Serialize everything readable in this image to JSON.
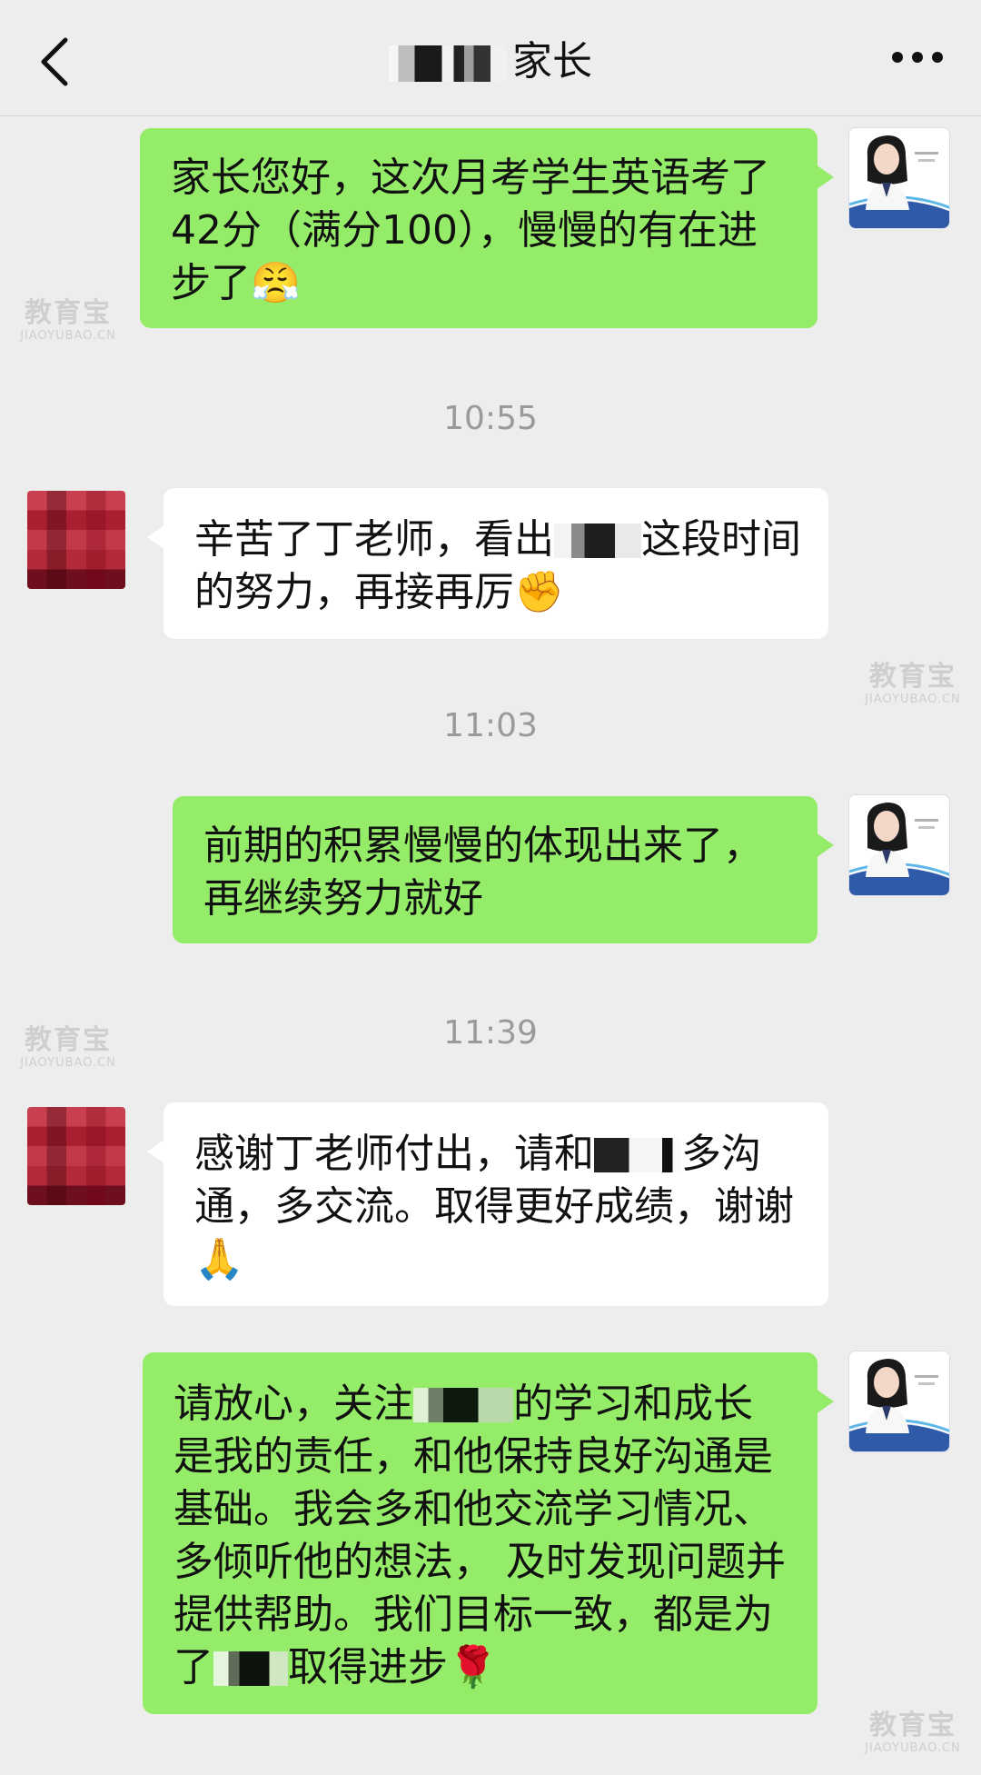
{
  "header": {
    "title": "家长"
  },
  "messages": [
    {
      "from": "me",
      "text": "家长您好，这次月考学生英语考了42分（满分100），慢慢的有在进步了",
      "emoji": "😤"
    },
    {
      "timestamp": "10:55"
    },
    {
      "from": "other",
      "text_before": "辛苦了丁老师，看出",
      "text_after": "这段时间的努力，再接再厉",
      "emoji": "✊"
    },
    {
      "timestamp": "11:03"
    },
    {
      "from": "me",
      "text": "前期的积累慢慢的体现出来了，再继续努力就好"
    },
    {
      "timestamp": "11:39"
    },
    {
      "from": "other",
      "text_before": "感谢丁老师付出，请和",
      "text_after": "多沟通，多交流。取得更好成绩，谢谢",
      "emoji": "🙏"
    },
    {
      "from": "me",
      "text_before": "请放心，关注",
      "text_middle": "的学习和成长是我的责任，和他保持良好沟通是基础。我会多和他交流学习情况、多倾听他的想法， 及时发现问题并提供帮助。我们目标一致，都是为了",
      "text_after": "取得进步",
      "emoji": "🌹"
    }
  ],
  "watermark": {
    "text": "教育宝",
    "sub": "JIAOYUBAO.CN"
  },
  "colors": {
    "background": "#ededed",
    "me_bubble": "#95ec69",
    "other_bubble": "#ffffff",
    "timestamp": "#9a9a9a"
  }
}
